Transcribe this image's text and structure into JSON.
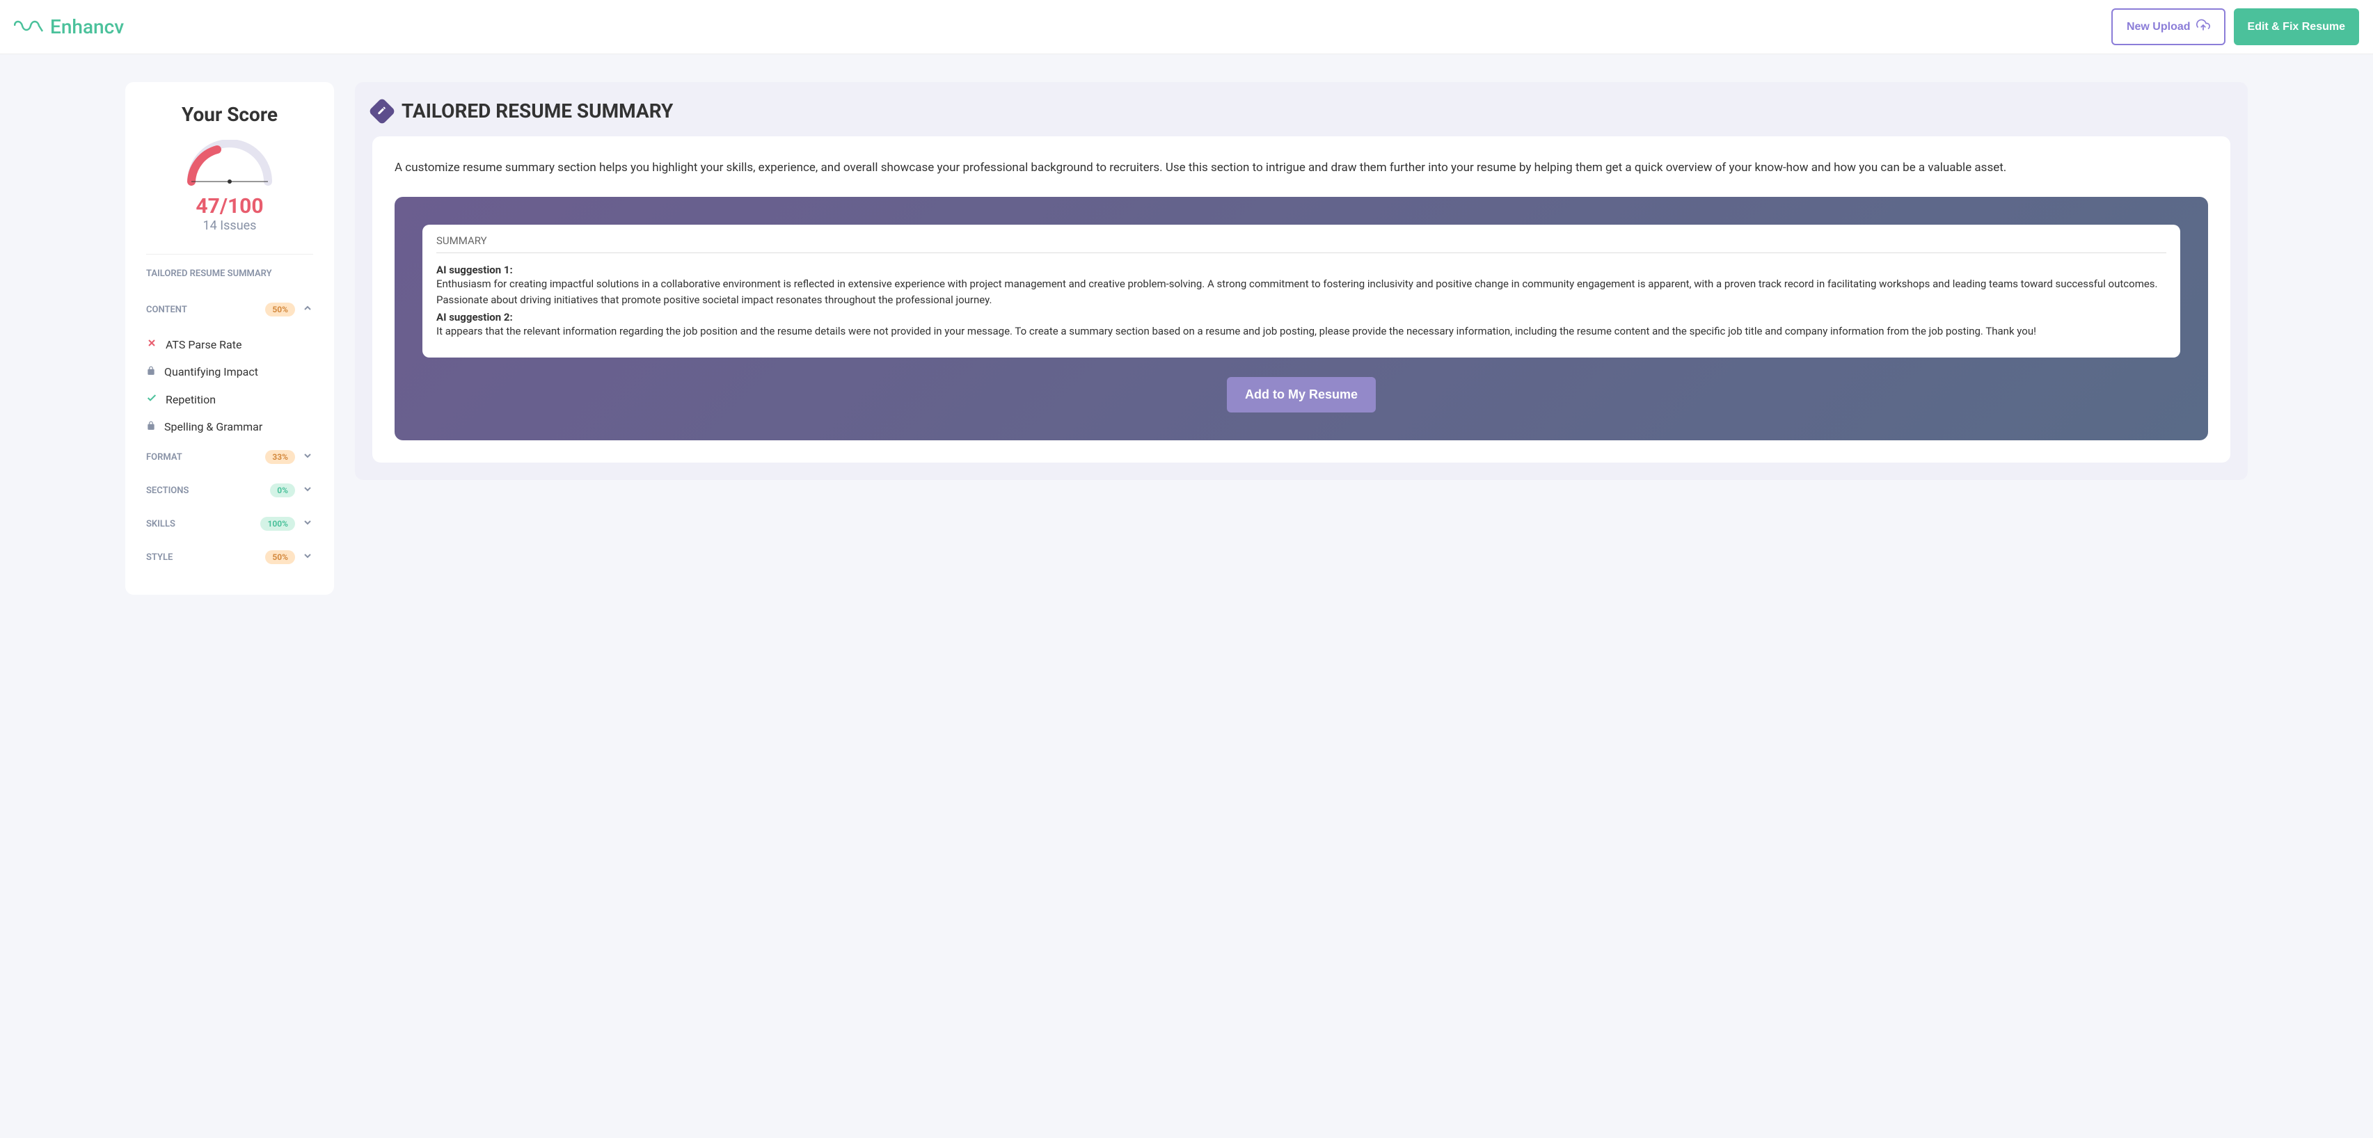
{
  "header": {
    "brand": "Enhancv",
    "new_upload": "New Upload",
    "edit_fix": "Edit & Fix Resume"
  },
  "sidebar": {
    "score_title": "Your Score",
    "score_value": "47/100",
    "issues": "14 Issues",
    "tailored": "TAILORED RESUME SUMMARY",
    "sections": [
      {
        "label": "CONTENT",
        "percent": "50%",
        "badge_class": "badge-orange",
        "expanded": true,
        "items": [
          {
            "icon": "x",
            "label": "ATS Parse Rate"
          },
          {
            "icon": "lock",
            "label": "Quantifying Impact"
          },
          {
            "icon": "check",
            "label": "Repetition"
          },
          {
            "icon": "lock",
            "label": "Spelling & Grammar"
          }
        ]
      },
      {
        "label": "FORMAT",
        "percent": "33%",
        "badge_class": "badge-orange",
        "expanded": false
      },
      {
        "label": "SECTIONS",
        "percent": "0%",
        "badge_class": "badge-green",
        "expanded": false
      },
      {
        "label": "SKILLS",
        "percent": "100%",
        "badge_class": "badge-green",
        "expanded": false
      },
      {
        "label": "STYLE",
        "percent": "50%",
        "badge_class": "badge-orange",
        "expanded": false
      }
    ]
  },
  "main": {
    "title": "TAILORED RESUME SUMMARY",
    "desc": "A customize resume summary section helps you highlight your skills, experience, and overall showcase your professional background to recruiters. Use this section to intrigue and draw them further into your resume by helping them get a quick overview of your know-how and how you can be a valuable asset.",
    "summary_title": "SUMMARY",
    "sug1_label": "AI suggestion 1:",
    "sug1_text": "Enthusiasm for creating impactful solutions in a collaborative environment is reflected in extensive experience with project management and creative problem-solving. A strong commitment to fostering inclusivity and positive change in community engagement is apparent, with a proven track record in facilitating workshops and leading teams toward successful outcomes. Passionate about driving initiatives that promote positive societal impact resonates throughout the professional journey.",
    "sug2_label": "AI suggestion 2:",
    "sug2_text": "It appears that the relevant information regarding the job position and the resume details were not provided in your message. To create a summary section based on a resume and job posting, please provide the necessary information, including the resume content and the specific job title and company information from the job posting. Thank you!",
    "add_button": "Add to My Resume"
  }
}
